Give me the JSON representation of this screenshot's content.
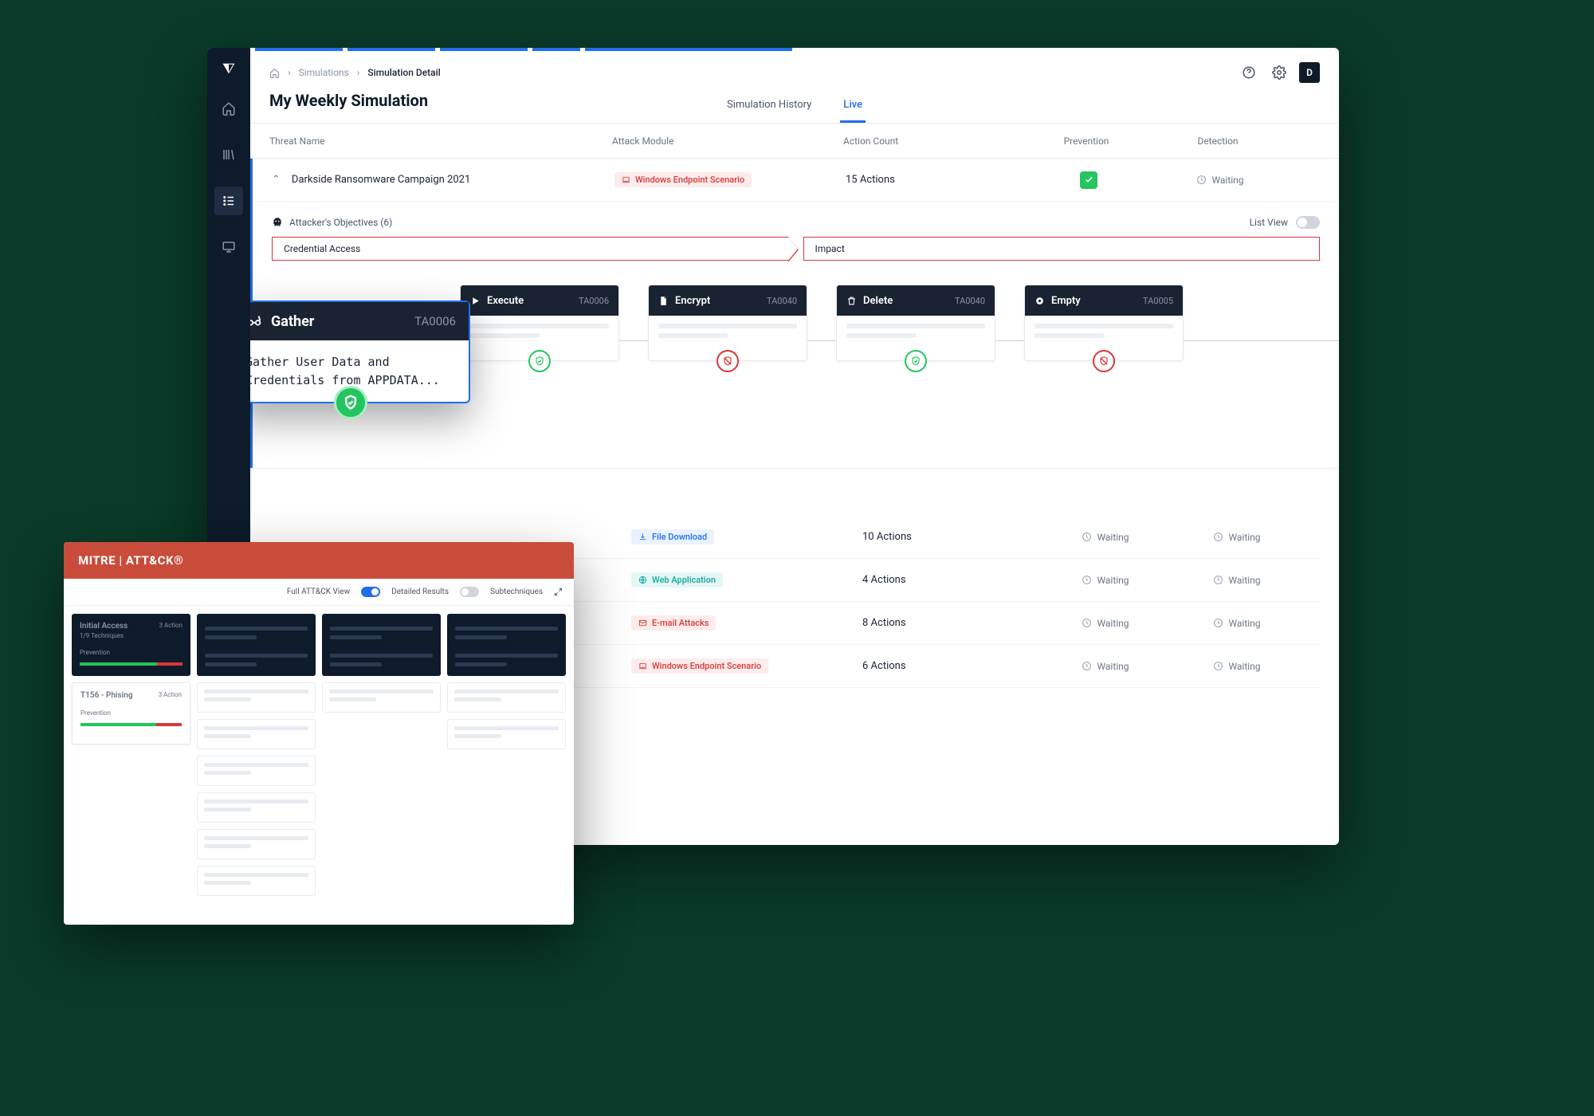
{
  "breadcrumb": {
    "home": "",
    "simulations": "Simulations",
    "current": "Simulation Detail"
  },
  "page_title": "My Weekly Simulation",
  "topbar": {
    "avatar_initial": "D"
  },
  "view_tabs": {
    "history": "Simulation History",
    "live": "Live"
  },
  "table_head": {
    "threat": "Threat Name",
    "module": "Attack Module",
    "actions": "Action Count",
    "prevention": "Prevention",
    "detection": "Detection"
  },
  "expanded_row": {
    "name": "Darkside Ransomware Campaign 2021",
    "module": "Windows Endpoint Scenario",
    "actions": "15 Actions",
    "detection": "Waiting"
  },
  "objectives": {
    "label": "Attacker's Objectives (6)",
    "list_view": "List View",
    "items": [
      "Credential Access",
      "Impact"
    ]
  },
  "gather_card": {
    "title": "Gather",
    "ta": "TA0006",
    "body": "Gather User Data and Credentials from APPDATA..."
  },
  "flow": [
    {
      "title": "Execute",
      "ta": "TA0006",
      "status": "green"
    },
    {
      "title": "Encrypt",
      "ta": "TA0040",
      "status": "red"
    },
    {
      "title": "Delete",
      "ta": "TA0040",
      "status": "green"
    },
    {
      "title": "Empty",
      "ta": "TA0005",
      "status": "red"
    }
  ],
  "bottom_rows": [
    {
      "module": "File Download",
      "tag": "blue",
      "icon": "download",
      "actions": "10 Actions",
      "prevention": "Waiting",
      "detection": "Waiting"
    },
    {
      "module": "Web Application",
      "tag": "cyan",
      "icon": "globe",
      "actions": "4 Actions",
      "prevention": "Waiting",
      "detection": "Waiting"
    },
    {
      "module": "E-mail Attacks",
      "tag": "red",
      "icon": "mail",
      "actions": "8 Actions",
      "prevention": "Waiting",
      "detection": "Waiting"
    },
    {
      "module": "Windows Endpoint Scenario",
      "tag": "red",
      "icon": "laptop",
      "actions": "6 Actions",
      "prevention": "Waiting",
      "detection": "Waiting"
    }
  ],
  "mitre": {
    "brand": "MITRE | ATT&CK®",
    "toolbar": {
      "full": "Full ATT&CK View",
      "detailed": "Detailed Results",
      "sub": "Subtechniques"
    },
    "card1": {
      "title": "Initial Access",
      "sub": "1/9 Techniques",
      "action": "3 Action",
      "prev": "Prevention"
    },
    "card2": {
      "title": "T156 - Phising",
      "action": "3 Action",
      "prev": "Prevention"
    }
  },
  "labels": {
    "waiting": "Waiting"
  }
}
